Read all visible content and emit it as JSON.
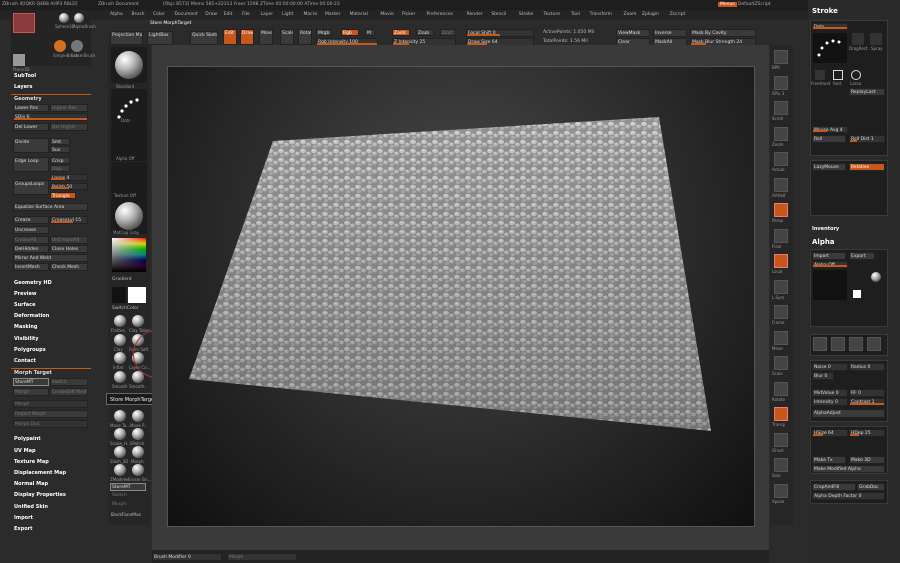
{
  "titlebar": {
    "app": "ZBrush 4[IQKR Q4B8 AHP3 R8LD]",
    "document": "ZBrush Document",
    "stats": "[Objs 8573] Mems 585+22313 Frees 1598 ZTime 00:00:00:00 ATime 00:00:23",
    "menus_label": "Menus",
    "script_label": "DefaultZScript"
  },
  "menubar": {
    "items": [
      "Alpha",
      "Brush",
      "Color",
      "Document",
      "Draw",
      "Edit",
      "File",
      "Layer",
      "Light",
      "Macro",
      "Marker",
      "Material",
      "Movie",
      "Picker",
      "Preferences",
      "Render",
      "Stencil",
      "Stroke",
      "Texture",
      "Tool",
      "Transform",
      "Zoom",
      "Zplugin",
      "Zscript"
    ]
  },
  "top_shelf": {
    "store_morph_target": "Store MorphTarget",
    "projection_master": "Projection Master",
    "lightbox": "LightBox",
    "quick_sketch": "Quick Sketch",
    "edit": "Edit",
    "draw": "Draw",
    "move": "Move",
    "scale": "Scale",
    "rotate": "Rotate",
    "mrgb": "Mrgb",
    "rgb": "Rgb",
    "m": "M",
    "rgb_intensity": "Rgb Intensity 100",
    "zadd": "Zadd",
    "zsub": "Zsub",
    "zcut": "Zcut",
    "z_intensity": "Z Intensity 25",
    "focal_shift": "Focal Shift 0",
    "draw_size": "Draw Size 64",
    "active_points": "ActivePoints: 1.050 Mil",
    "total_points": "TotalPoints: 1.56 Mil",
    "view_mask": "ViewMask",
    "inverse": "Inverse",
    "mask_by_cavity": "Mask By Cavity",
    "clear": "Clear",
    "mask_all": "MaskAll",
    "mask_blur_strength": "Mask Blur Strength 24"
  },
  "left_panel": {
    "tool_thumbs": [
      "Sphere3D",
      "PM3D_S...",
      "AlphaBrush",
      "SimpleBrush",
      "EraserBrush",
      "Plane3D"
    ],
    "subtool": "SubTool",
    "layers": "Layers",
    "geometry": "Geometry",
    "lower_res": "Lower Res",
    "higher_res": "Higher Res",
    "sdiv": "SDiv 6",
    "del_lower": "Del Lower",
    "del_higher": "Del Higher",
    "divide": "Divide",
    "smt": "Smt",
    "suv": "Suv",
    "edge_loop": "Edge Loop",
    "crisp": "Crisp",
    "disp": "Disp",
    "groups_loops": "GroupsLoops",
    "loops": "Loops 4",
    "polish": "Polish 50",
    "triangle": "Triangle",
    "equalize": "Equalize Surface Area",
    "crease": "Crease",
    "crease_lvl": "CreaseLvl 15",
    "uncrease": "Uncrease",
    "crease_all": "CreaseAll",
    "uncrease_all": "UnCreaseAll",
    "del_hidden": "DelHidden",
    "close_holes": "Close Holes",
    "mirror_weld": "Mirror And Weld",
    "insert_mesh": "InsertMesh",
    "check_mesh": "Check Mesh",
    "geometry_hd": "Geometry HD",
    "preview": "Preview",
    "surface": "Surface",
    "deformation": "Deformation",
    "masking": "Masking",
    "visibility": "Visibility",
    "polygroups": "Polygroups",
    "contact": "Contact",
    "morph_target": "Morph Target",
    "store_mt": "StoreMT",
    "switch": "Switch",
    "morph": "Morph",
    "create_diff_mesh": "CreateDiff Mesh",
    "morph_dial": "Morph",
    "project_morph": "Project Morph",
    "morph_dist": "Morph Dist",
    "polypaint": "Polypaint",
    "uv_map": "UV Map",
    "texture_map": "Texture Map",
    "displacement_map": "Displacement Map",
    "normal_map": "Normal Map",
    "display_properties": "Display Properties",
    "unified_skin": "Unified Skin",
    "import": "Import",
    "export": "Export"
  },
  "brush_column": {
    "labels": [
      "Standard",
      "Dots",
      "Alpha Off",
      "Texture Off",
      "MatCap Gray",
      "Gradient",
      "SwitchColor",
      "Flatten",
      "Clay Tubes",
      "Clay",
      "Form Soft",
      "Inflat",
      "Layer Co...",
      "Smooth",
      "Smooth..",
      "Move Ta...",
      "Move P...",
      "Snake_H...",
      "SPolish",
      "Slash_3D",
      "Morph",
      "ZModeler",
      "Eraser Bri..."
    ],
    "tooltip": "Store MorphTarget",
    "store_mt": "StoreMT",
    "switch": "Switch",
    "morph": "Morph",
    "backface": "BackFaceMas"
  },
  "right_tools": {
    "items": [
      "BPR",
      "SPix 3",
      "Scroll",
      "Zoom",
      "Actual",
      "AAHalf",
      "Persp",
      "Floor",
      "Local",
      "L.Sym",
      "Frame",
      "Move",
      "Scale",
      "Rotate",
      "Transp",
      "Ghost",
      "Solo",
      "Xpose"
    ]
  },
  "right_panel": {
    "stroke": "Stroke",
    "dots": "Dots",
    "drag_rect": "DragRect",
    "spray": "Spray",
    "freehand": "FreeHand",
    "rect": "Rect",
    "lasso": "Lasso",
    "replay_last": "ReplayLast",
    "mouse_avg": "Mouse Avg 4",
    "roll": "Roll",
    "roll_dist": "Roll Dist 1",
    "lazy_mouse": "LazyMouse",
    "relative": "Relative",
    "inventory": "Inventory",
    "alpha": "Alpha",
    "import": "Import",
    "export": "Export",
    "alpha_off": "Alpha Off",
    "noise": "Noise 0",
    "radius": "Radius 0",
    "blur": "Blur 0",
    "rf": "RF 0",
    "mid_value": "MidValue 0",
    "intensity": "Intensity 0",
    "contrast": "Contrast 1",
    "alpha_adjust": "AlphaAdjust",
    "hsize": "HSize 64",
    "hdep": "HDep 25",
    "make_tx": "Make Tx",
    "make_3d": "Make 3D",
    "make_modified_alpha": "Make Modified Alpha",
    "crop_and_fill": "CropAndFill",
    "grab_doc": "GrabDoc",
    "alpha_depth_factor": "Alpha Depth Factor 0"
  },
  "bottom": {
    "brush_modifier": "Brush Modifier 0",
    "morph": "Morph"
  },
  "colors": {
    "accent": "#c8581a",
    "panel": "#2b2b2b",
    "button": "#3a3a3a"
  }
}
